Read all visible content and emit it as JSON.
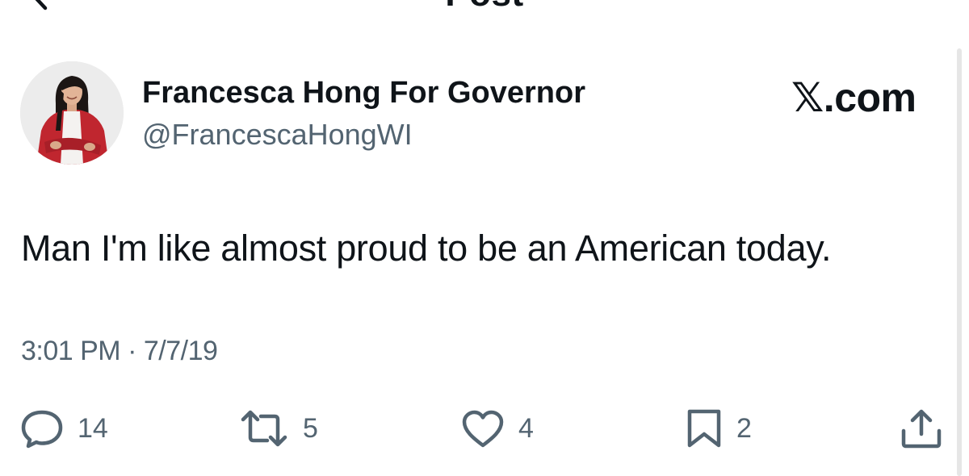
{
  "header": {
    "title": "Post"
  },
  "author": {
    "name": "Francesca Hong For Governor",
    "handle": "@FrancescaHongWI"
  },
  "watermark": {
    "text": ".com"
  },
  "post": {
    "text": "Man I'm like almost proud to be an American today.",
    "time": "3:01 PM",
    "separator": "·",
    "date": "7/7/19"
  },
  "actions": {
    "replies": "14",
    "reposts": "5",
    "likes": "4",
    "bookmarks": "2"
  },
  "icons": {
    "back": "back-arrow-icon",
    "more": "more-icon",
    "reply": "reply-icon",
    "repost": "repost-icon",
    "like": "heart-icon",
    "bookmark": "bookmark-icon",
    "share": "share-icon"
  }
}
